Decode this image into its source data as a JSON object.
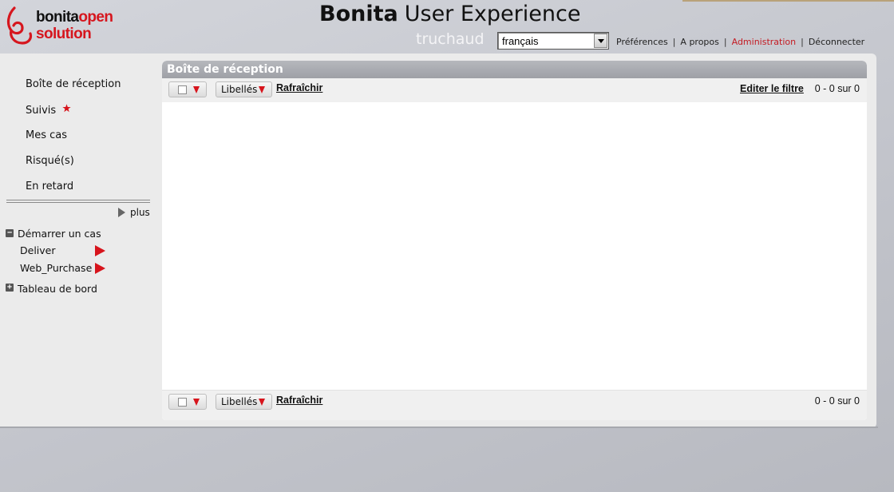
{
  "header": {
    "logo": {
      "line1_a": "bonita",
      "line1_b": "open",
      "line2": "solution"
    },
    "title_brand": "Bonita",
    "title_rest": "User Experience",
    "username": "truchaud",
    "language": {
      "selected": "français"
    },
    "links": {
      "preferences": "Préférences",
      "about": "A propos",
      "administration": "Administration",
      "logout": "Déconnecter",
      "separator": "|"
    }
  },
  "sidebar": {
    "items": [
      {
        "label": "Boîte de réception"
      },
      {
        "label": "Suivis"
      },
      {
        "label": "Mes cas"
      },
      {
        "label": "Risqué(s)"
      },
      {
        "label": "En retard"
      }
    ],
    "more_label": "plus",
    "start_case": {
      "label": "Démarrer un cas",
      "toggle": "−",
      "processes": [
        {
          "label": "Deliver"
        },
        {
          "label": "Web_Purchase"
        }
      ]
    },
    "dashboard": {
      "label": "Tableau de bord",
      "toggle": "+"
    }
  },
  "inbox": {
    "title": "Boîte de réception",
    "labels_button": "Libellés",
    "refresh": "Rafraîchir",
    "edit_filter": "Editer le filtre",
    "pager_top": "0 - 0 sur 0",
    "pager_bottom": "0 - 0 sur 0"
  },
  "colors": {
    "accent_red": "#d7141c",
    "admin_link": "#c41a22",
    "panel_header": "#a7a9ae"
  }
}
